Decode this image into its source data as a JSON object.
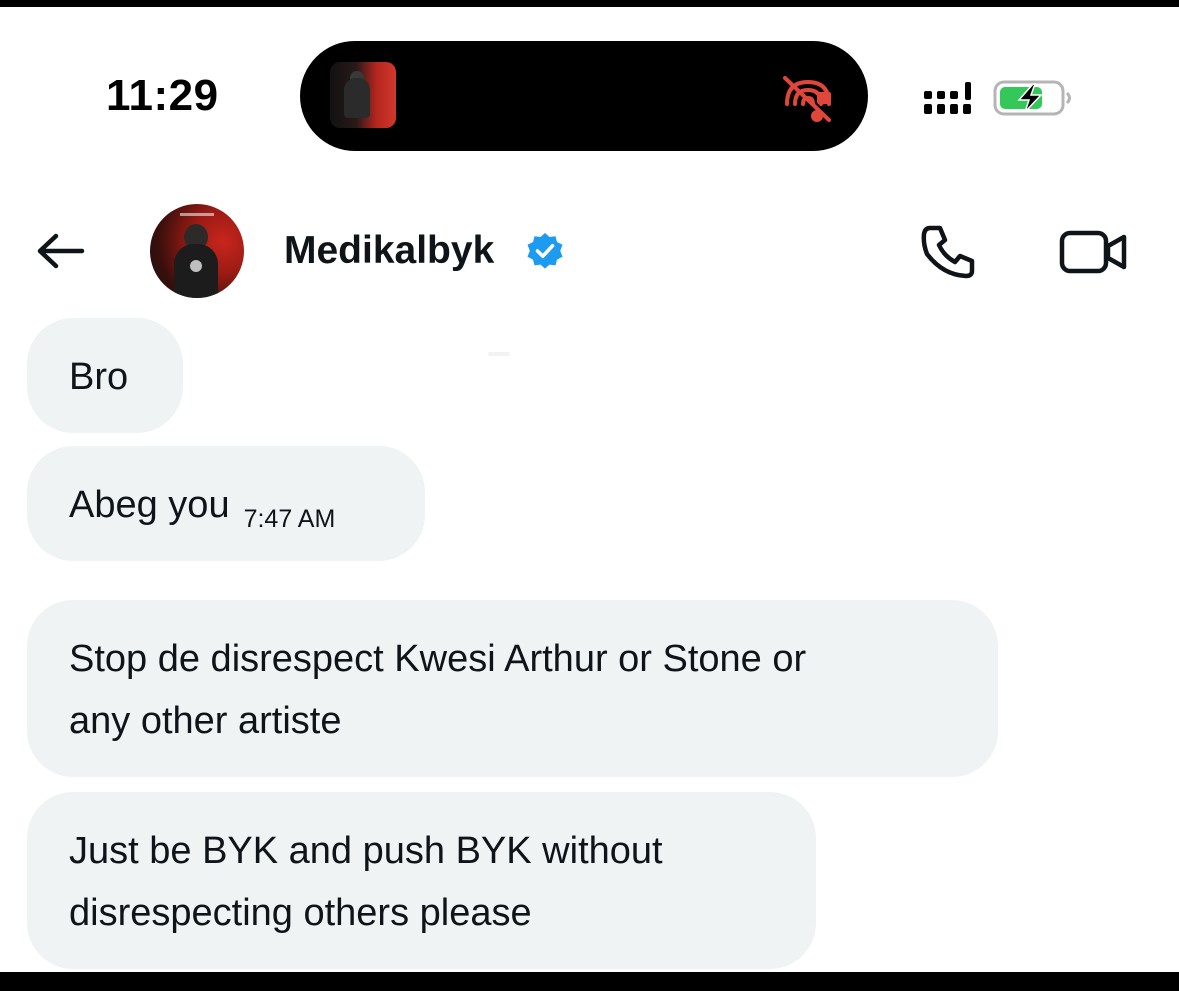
{
  "status_bar": {
    "time": "11:29",
    "battery_state": "charging",
    "battery_color": "#34c759",
    "now_playing_icon": "album-art-icon",
    "muted_icon": "mute-icon"
  },
  "header": {
    "back_icon": "back-arrow-icon",
    "contact_name": "Medikalbyk",
    "verified_icon": "verified-badge-icon",
    "verified_color": "#1d9bf0",
    "call_icon": "phone-icon",
    "video_icon": "video-camera-icon"
  },
  "messages": [
    {
      "text": "Bro",
      "time": ""
    },
    {
      "text": "Abeg you",
      "time": "7:47 AM"
    },
    {
      "lines": [
        "Stop de disrespect Kwesi Arthur or Stone or",
        "any other artiste"
      ]
    },
    {
      "lines": [
        "Just be BYK and push BYK without",
        "disrespecting others please"
      ]
    }
  ],
  "colors": {
    "bubble_background": "#eff3f4",
    "text": "#0f1419"
  }
}
